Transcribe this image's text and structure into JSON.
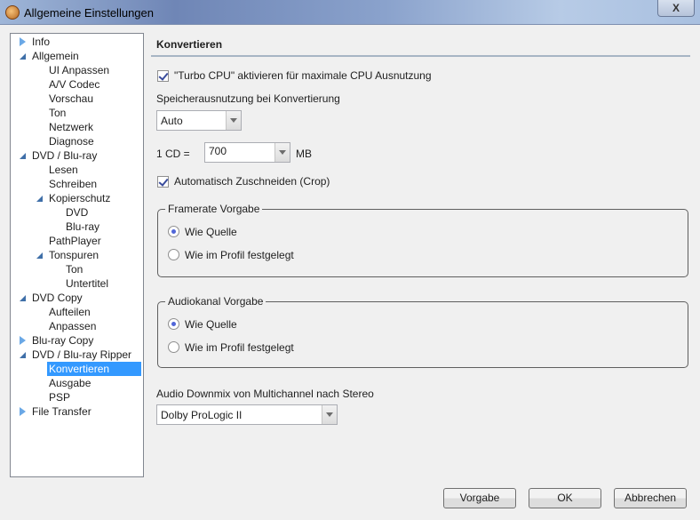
{
  "window": {
    "title": "Allgemeine Einstellungen",
    "close_label": "X"
  },
  "tree": [
    {
      "label": "Info",
      "level": 0,
      "arrow": "closed"
    },
    {
      "label": "Allgemein",
      "level": 0,
      "arrow": "open"
    },
    {
      "label": "UI Anpassen",
      "level": 1
    },
    {
      "label": "A/V Codec",
      "level": 1
    },
    {
      "label": "Vorschau",
      "level": 1
    },
    {
      "label": "Ton",
      "level": 1
    },
    {
      "label": "Netzwerk",
      "level": 1
    },
    {
      "label": "Diagnose",
      "level": 1
    },
    {
      "label": "DVD / Blu-ray",
      "level": 0,
      "arrow": "open"
    },
    {
      "label": "Lesen",
      "level": 1
    },
    {
      "label": "Schreiben",
      "level": 1
    },
    {
      "label": "Kopierschutz",
      "level": 1,
      "arrow": "open"
    },
    {
      "label": "DVD",
      "level": 2
    },
    {
      "label": "Blu-ray",
      "level": 2
    },
    {
      "label": "PathPlayer",
      "level": 1
    },
    {
      "label": "Tonspuren",
      "level": 1,
      "arrow": "open"
    },
    {
      "label": "Ton",
      "level": 2
    },
    {
      "label": "Untertitel",
      "level": 2
    },
    {
      "label": "DVD Copy",
      "level": 0,
      "arrow": "open"
    },
    {
      "label": "Aufteilen",
      "level": 1
    },
    {
      "label": "Anpassen",
      "level": 1
    },
    {
      "label": "Blu-ray Copy",
      "level": 0,
      "arrow": "closed"
    },
    {
      "label": "DVD / Blu-ray Ripper",
      "level": 0,
      "arrow": "open"
    },
    {
      "label": "Konvertieren",
      "level": 1,
      "selected": true
    },
    {
      "label": "Ausgabe",
      "level": 1
    },
    {
      "label": "PSP",
      "level": 1
    },
    {
      "label": "File Transfer",
      "level": 0,
      "arrow": "closed"
    }
  ],
  "main": {
    "heading": "Konvertieren",
    "turbo_cpu": {
      "label": "\"Turbo CPU\" aktivieren für maximale CPU Ausnutzung",
      "checked": true
    },
    "memory_label": "Speicherausnutzung bei Konvertierung",
    "memory_value": "Auto",
    "cd_label": "1 CD =",
    "cd_value": "700",
    "cd_unit": "MB",
    "crop": {
      "label": "Automatisch Zuschneiden (Crop)",
      "checked": true
    },
    "framerate": {
      "title": "Framerate Vorgabe",
      "options": [
        "Wie Quelle",
        "Wie im Profil festgelegt"
      ],
      "selected": 0
    },
    "audiochannel": {
      "title": "Audiokanal Vorgabe",
      "options": [
        "Wie Quelle",
        "Wie im Profil festgelegt"
      ],
      "selected": 0
    },
    "downmix_label": "Audio Downmix von Multichannel nach Stereo",
    "downmix_value": "Dolby ProLogic II"
  },
  "buttons": {
    "default": "Vorgabe",
    "ok": "OK",
    "cancel": "Abbrechen"
  }
}
